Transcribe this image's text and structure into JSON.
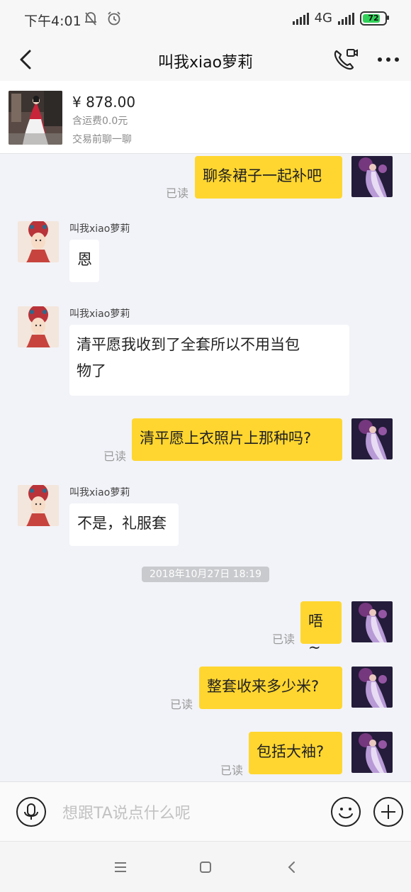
{
  "status_bar": {
    "time": "下午4:01",
    "network": "4G",
    "battery": "72",
    "icons": [
      "mute-bell-icon",
      "alarm-icon",
      "signal-icon",
      "battery-icon"
    ]
  },
  "nav": {
    "title": "叫我xiao萝莉",
    "icons": [
      "back-arrow-icon",
      "video-call-icon",
      "more-icon"
    ]
  },
  "product": {
    "price": "¥ 878.00",
    "shipping": "含运费0.0元",
    "hint": "交易前聊一聊"
  },
  "chat": {
    "sender_name": "叫我xiao萝莉",
    "read_label": "已读",
    "timestamp": "2018年10月27日 18:19",
    "messages": [
      {
        "from": "me",
        "text": "聊条裙子一起补吧",
        "status": "已读"
      },
      {
        "from": "other",
        "sender": "叫我xiao萝莉",
        "text": "恩"
      },
      {
        "from": "other",
        "sender": "叫我xiao萝莉",
        "lines": [
          "清平愿我收到了全套所以不用当包",
          "物了"
        ]
      },
      {
        "from": "me",
        "text": "清平愿上衣照片上那种吗?",
        "status": "已读"
      },
      {
        "from": "other",
        "sender": "叫我xiao萝莉",
        "text": "不是，礼服套"
      },
      {
        "from": "me",
        "text": "唔~",
        "status": "已读"
      },
      {
        "from": "me",
        "text": "整套收来多少米?",
        "status": "已读"
      },
      {
        "from": "me",
        "text": "包括大袖?",
        "status": "已读"
      }
    ]
  },
  "input": {
    "placeholder": "想跟TA说点什么呢",
    "icons": [
      "microphone-icon",
      "emoji-icon",
      "plus-icon"
    ]
  },
  "system_nav": {
    "icons": [
      "menu-icon",
      "home-icon",
      "back-icon"
    ]
  },
  "colors": {
    "my_bubble": "#ffd630",
    "other_bubble": "#ffffff",
    "background": "#f2f3f8",
    "read_text": "#9a9a9a"
  }
}
